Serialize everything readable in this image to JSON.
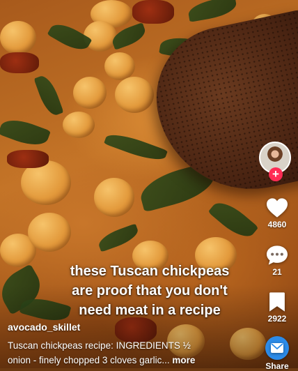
{
  "video": {
    "caption_lines": [
      "these Tuscan chickpeas",
      "are proof that you don't",
      "need meat in a recipe"
    ]
  },
  "author": {
    "username": "avocado_skillet"
  },
  "description": {
    "line1": "Tuscan chickpeas recipe: INGREDIENTS ½",
    "line2": "onion - finely chopped 3 cloves garlic...",
    "more_label": "more"
  },
  "actions": {
    "follow_symbol": "+",
    "like_count": "4860",
    "comment_count": "21",
    "bookmark_count": "2922",
    "share_label": "Share"
  },
  "colors": {
    "follow_badge": "#ff2b54",
    "share_button": "#2c8be8"
  }
}
